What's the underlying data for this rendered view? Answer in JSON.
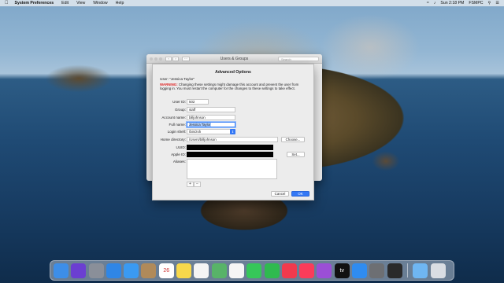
{
  "menubar": {
    "apple": "",
    "app_name": "System Preferences",
    "items": [
      "Edit",
      "View",
      "Window",
      "Help"
    ],
    "clock": "Sun 2:18 PM",
    "user": "FSMPC"
  },
  "prefs_window": {
    "title": "Users & Groups",
    "search_placeholder": "Search"
  },
  "sheet": {
    "title": "Advanced Options",
    "user_line": "User: “Jessica Taylor”",
    "warning_label": "WARNING:",
    "warning_text": "Changing these settings might damage this account and prevent the user from logging in. You must restart the computer for the changes to these settings to take effect.",
    "fields": {
      "user_id_label": "User ID:",
      "user_id": "502",
      "group_label": "Group:",
      "group": "staff",
      "account_name_label": "Account name:",
      "account_name": "billjohnson",
      "full_name_label": "Full name:",
      "full_name": "Jessica Taylor",
      "login_shell_label": "Login shell:",
      "login_shell": "/bin/zsh",
      "home_dir_label": "Home directory:",
      "home_dir": "/Users/billjohnson",
      "choose_button": "Choose...",
      "uuid_label": "UUID:",
      "apple_id_label": "Apple ID:",
      "set_button": "Set...",
      "aliases_label": "Aliases:"
    },
    "add_symbol": "+",
    "remove_symbol": "−",
    "cancel_button": "Cancel",
    "ok_button": "OK"
  },
  "dock": {
    "apps": [
      {
        "name": "finder-icon",
        "color": "#3d8ee8"
      },
      {
        "name": "siri-icon",
        "color": "#6b3fd1"
      },
      {
        "name": "launchpad-icon",
        "color": "#8a8f99"
      },
      {
        "name": "safari-icon",
        "color": "#2f86e6"
      },
      {
        "name": "mail-icon",
        "color": "#3a9af2"
      },
      {
        "name": "contacts-icon",
        "color": "#b08a5a"
      },
      {
        "name": "calendar-icon",
        "color": "#ffffff",
        "glyph": "26"
      },
      {
        "name": "notes-icon",
        "color": "#f7d84b"
      },
      {
        "name": "reminders-icon",
        "color": "#f4f4f4"
      },
      {
        "name": "maps-icon",
        "color": "#58b368"
      },
      {
        "name": "photos-icon",
        "color": "#f5f5f5"
      },
      {
        "name": "messages-icon",
        "color": "#36c759"
      },
      {
        "name": "facetime-icon",
        "color": "#2fba4f"
      },
      {
        "name": "news-icon",
        "color": "#f23a4d"
      },
      {
        "name": "music-icon",
        "color": "#fa3c5a"
      },
      {
        "name": "podcasts-icon",
        "color": "#9b4fd6"
      },
      {
        "name": "tv-icon",
        "color": "#111111",
        "glyph": "tv"
      },
      {
        "name": "app-store-icon",
        "color": "#2f8cf0"
      },
      {
        "name": "system-preferences-icon",
        "color": "#6d6f73"
      },
      {
        "name": "quicktime-icon",
        "color": "#2a2a2a"
      }
    ],
    "trailing": [
      {
        "name": "downloads-folder-icon",
        "color": "#6fb6f2"
      },
      {
        "name": "trash-icon",
        "color": "#d9dde3"
      }
    ]
  }
}
